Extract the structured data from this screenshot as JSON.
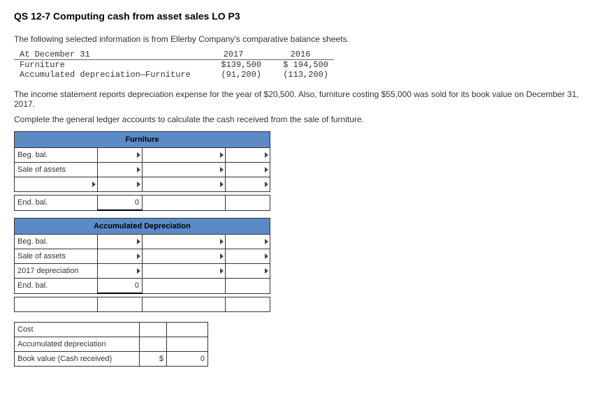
{
  "title": "QS 12-7 Computing cash from asset sales LO P3",
  "intro": "The following selected information is from Ellerby Company's comparative balance sheets.",
  "balance": {
    "header": "At December 31",
    "y1": "2017",
    "y2": "2016",
    "rows": [
      {
        "label": "Furniture",
        "v1": "$139,500",
        "v2": "$ 194,500"
      },
      {
        "label": "Accumulated depreciation—Furniture",
        "v1": "(91,200)",
        "v2": "(113,200)"
      }
    ]
  },
  "para2": "The income statement reports depreciation expense for the year of $20,500. Also, furniture costing $55,000 was sold for its book value on December 31, 2017.",
  "para3": "Complete the general ledger accounts to calculate the cash received from the sale of furniture.",
  "furniture": {
    "title": "Furniture",
    "r1": "Beg. bal.",
    "r2": "Sale of assets",
    "end": "End. bal.",
    "endval": "0"
  },
  "accdep": {
    "title": "Accumulated Depreciation",
    "r1": "Beg. bal.",
    "r2": "Sale of assets",
    "r3": "2017 depreciation",
    "end": "End. bal.",
    "endval": "0"
  },
  "calc": {
    "r1": "Cost",
    "r2": "Accumulated depreciation",
    "r3": "Book value (Cash received)",
    "sym": "$",
    "val": "0"
  }
}
